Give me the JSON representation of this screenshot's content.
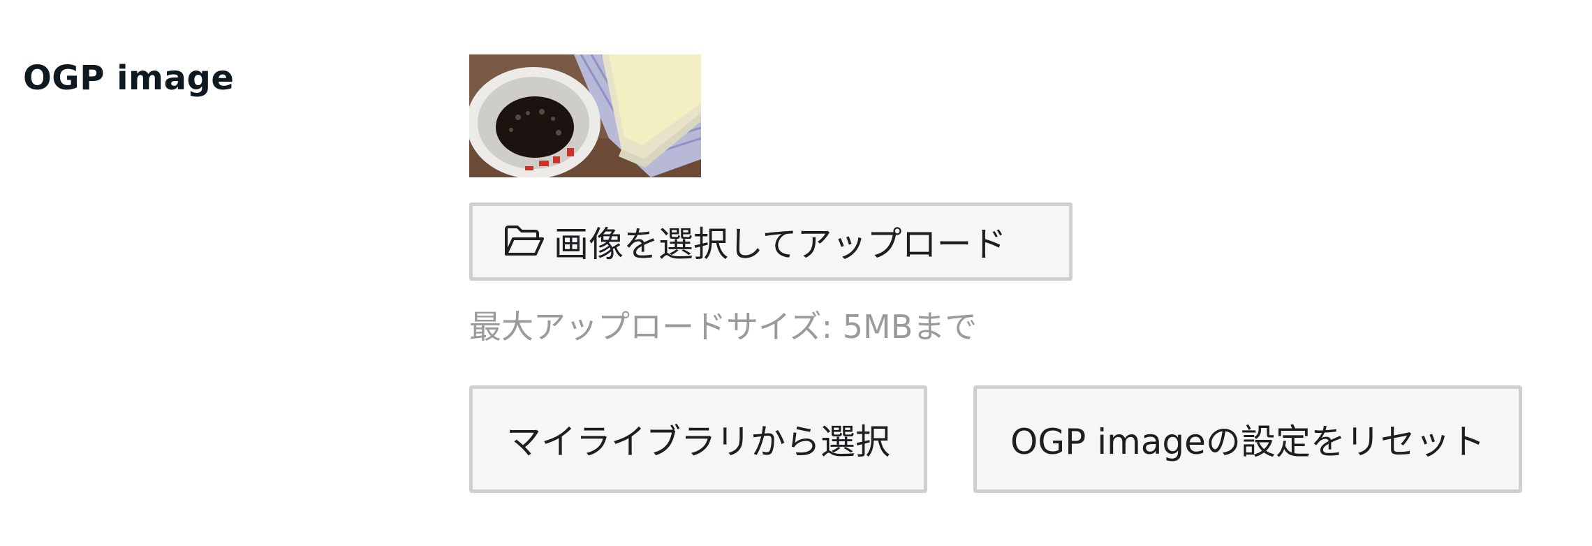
{
  "field": {
    "label": "OGP image"
  },
  "preview": {
    "alt": "coffee cup and book photo"
  },
  "upload": {
    "icon": "folder-open-icon",
    "label": "画像を選択してアップロード",
    "hint": "最大アップロードサイズ: 5MBまで"
  },
  "actions": {
    "library_label": "マイライブラリから選択",
    "reset_label": "OGP imageの設定をリセット"
  },
  "colors": {
    "button_bg": "#f6f6f6",
    "button_border": "#cfcfcf",
    "hint_text": "#9a9a9a",
    "label_text": "#0f1a20"
  }
}
